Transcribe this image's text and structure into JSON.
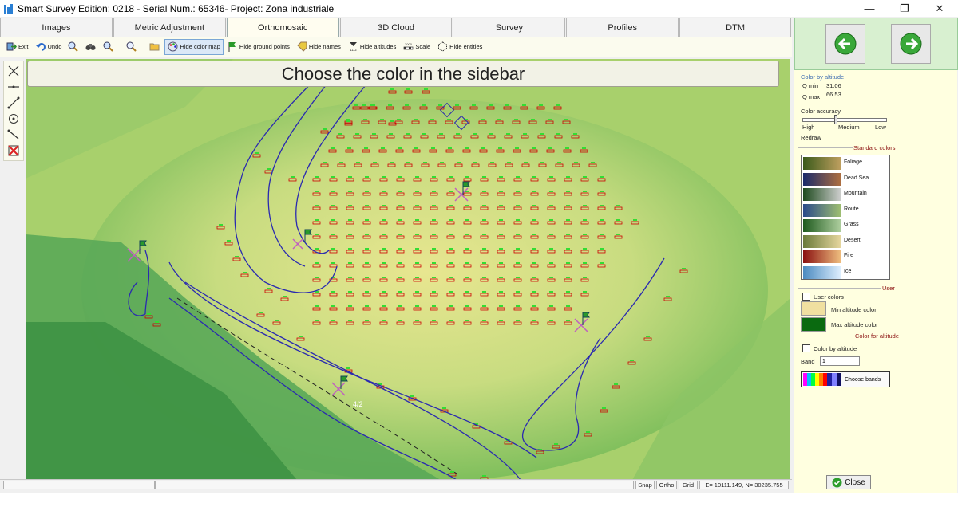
{
  "window": {
    "title": "Smart Survey  Edition: 0218 - Serial Num.: 65346- Project: Zona industriale",
    "minimize_glyph": "—",
    "maximize_glyph": "❐",
    "close_glyph": "✕"
  },
  "tabs": [
    {
      "label": "Images",
      "active": false
    },
    {
      "label": "Metric Adjustment",
      "active": false
    },
    {
      "label": "Orthomosaic",
      "active": true
    },
    {
      "label": "3D Cloud",
      "active": false
    },
    {
      "label": "Survey",
      "active": false
    },
    {
      "label": "Profiles",
      "active": false
    },
    {
      "label": "DTM",
      "active": false
    }
  ],
  "toolbar": {
    "exit": "Exit",
    "undo": "Undo",
    "hide_color_map": "Hide color map",
    "hide_ground_points": "Hide ground points",
    "hide_names": "Hide names",
    "hide_altitudes": "Hide altitudes",
    "scale_icon_text": "3000",
    "scale": "Scale",
    "hide_entities": "Hide entities",
    "altitude_icon_text": "11.2"
  },
  "banner": "Choose the color in the sidebar",
  "map": {
    "scale_label": "4/2"
  },
  "statusbar": {
    "snap": "Snap",
    "ortho": "Ortho",
    "grid": "Grid",
    "coords": "E= 10111.149, N= 30235.755"
  },
  "sidebar": {
    "section_title": "Color by altitude",
    "qmin_label": "Q min",
    "qmin_value": "31.06",
    "qmax_label": "Q max",
    "qmax_value": "66.53",
    "accuracy_label": "Color accuracy",
    "acc_high": "High",
    "acc_medium": "Medium",
    "acc_low": "Low",
    "redraw": "Redraw",
    "standard_colors": "Standard colors",
    "swatches": [
      {
        "name": "Foliage",
        "from": "#3a5a1a",
        "to": "#c0a060"
      },
      {
        "name": "Dead Sea",
        "from": "#1a2a6a",
        "to": "#b07040"
      },
      {
        "name": "Mountain",
        "from": "#1e4a1e",
        "to": "#d0d0d0"
      },
      {
        "name": "Route",
        "from": "#2a4a8a",
        "to": "#a0c070"
      },
      {
        "name": "Grass",
        "from": "#1e5a1e",
        "to": "#b0d0a0"
      },
      {
        "name": "Desert",
        "from": "#6a7a3a",
        "to": "#e8d8a0"
      },
      {
        "name": "Fire",
        "from": "#8a1010",
        "to": "#f0c080"
      },
      {
        "name": "Ice",
        "from": "#4a8ac0",
        "to": "#e0f0ff"
      }
    ],
    "user_header": "User",
    "user_colors": "User colors",
    "min_altitude_color": "Min altitude color",
    "min_color": "#f0e0a0",
    "max_altitude_color": "Max altitude color",
    "max_color": "#0a6a10",
    "color_for_altitude": "Color for altitude",
    "color_by_altitude_check": "Color by altitude",
    "band_label": "Band",
    "band_value": "1",
    "choose_bands": "Choose bands",
    "close": "Close"
  },
  "colors": {
    "accent_green": "#2e9e2e",
    "map_low": "#e8e290",
    "map_high": "#3e9a3e",
    "road": "#2a2ab0",
    "point_label": "#cc0000"
  }
}
